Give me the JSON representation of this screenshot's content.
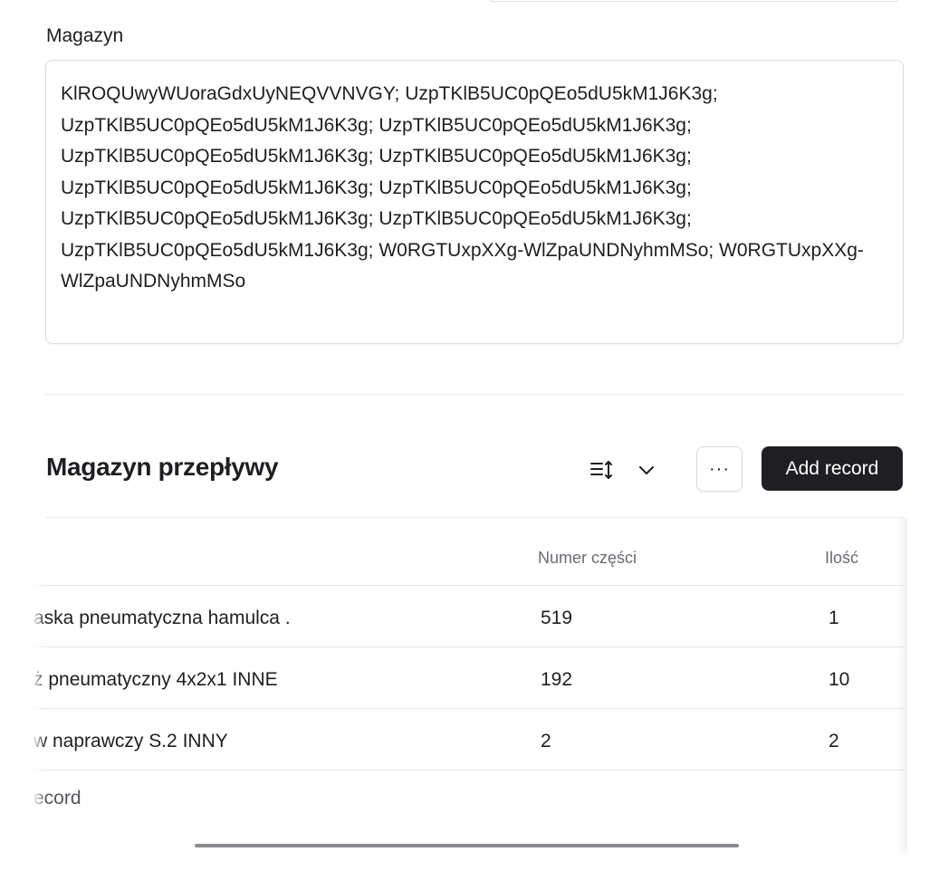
{
  "field": {
    "label": "Magazyn",
    "value": "KlROQUwyWUoraGdxUyNEQVVNVGY; UzpTKlB5UC0pQEo5dU5kM1J6K3g; UzpTKlB5UC0pQEo5dU5kM1J6K3g; UzpTKlB5UC0pQEo5dU5kM1J6K3g; UzpTKlB5UC0pQEo5dU5kM1J6K3g; UzpTKlB5UC0pQEo5dU5kM1J6K3g; UzpTKlB5UC0pQEo5dU5kM1J6K3g; UzpTKlB5UC0pQEo5dU5kM1J6K3g; UzpTKlB5UC0pQEo5dU5kM1J6K3g; UzpTKlB5UC0pQEo5dU5kM1J6K3g; UzpTKlB5UC0pQEo5dU5kM1J6K3g; W0RGTUxpXXg-WlZpaUNDNyhmMSo; W0RGTUxpXXg-WlZpaUNDNyhmMSo"
  },
  "section": {
    "title": "Magazyn przepływy",
    "sort_icon": "sort-icon",
    "chevron_icon": "chevron-down-icon",
    "more_label": "···",
    "add_label": "Add record"
  },
  "table": {
    "columns": [
      "",
      "Numer części",
      "Ilość"
    ],
    "rows": [
      {
        "name": "aska pneumatyczna hamulca .",
        "part": "519",
        "qty": "1"
      },
      {
        "name": "ż pneumatyczny 4x2x1 INNE",
        "part": "192",
        "qty": "10"
      },
      {
        "name": "w naprawczy S.2 INNY",
        "part": "2",
        "qty": "2"
      }
    ],
    "add_row_label": "ecord"
  }
}
